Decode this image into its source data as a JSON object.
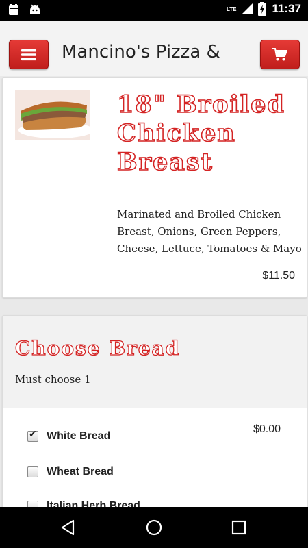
{
  "status_bar": {
    "network": "LTE",
    "time": "11:37",
    "icons": [
      "notification-icon",
      "android-icon",
      "signal-icon",
      "battery-charging-icon"
    ]
  },
  "app_bar": {
    "title": "Mancino's Pizza &",
    "menu_icon": "hamburger-menu-icon",
    "cart_icon": "shopping-cart-icon",
    "accent": "#d42424"
  },
  "product": {
    "image": "sub-sandwich-image",
    "title": "18\" Broiled Chicken Breast",
    "description": "Marinated and Broiled Chicken Breast, Onions, Green Peppers, Cheese, Lettuce, Tomatoes & Mayo",
    "price": "$11.50"
  },
  "options": {
    "title": "Choose Bread",
    "subtitle": "Must choose 1",
    "items": [
      {
        "label": "White Bread",
        "checked": true,
        "price": "$0.00"
      },
      {
        "label": "Wheat Bread",
        "checked": false
      },
      {
        "label": "Italian Herb Bread",
        "checked": false
      }
    ]
  },
  "nav_bar": {
    "icons": [
      "back-icon",
      "home-icon",
      "recents-icon"
    ]
  }
}
